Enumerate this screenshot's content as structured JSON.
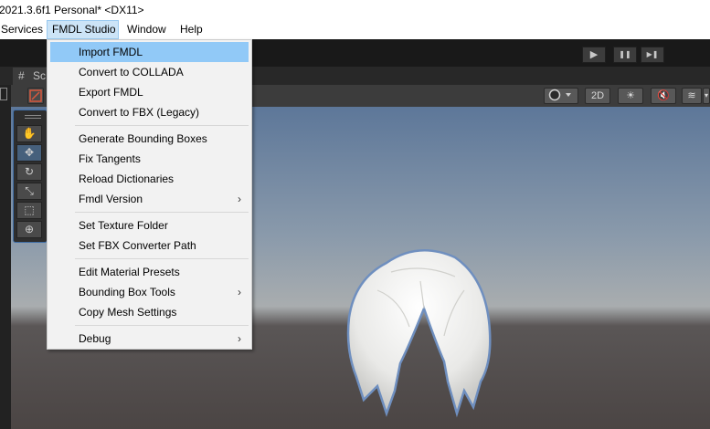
{
  "window": {
    "title": "2021.3.6f1 Personal* <DX11>"
  },
  "menubar": {
    "items": [
      "Services",
      "FMDL Studio",
      "Window",
      "Help"
    ]
  },
  "play_controls": {
    "play": "▶",
    "pause": "❚❚",
    "step": "▶❚"
  },
  "scene_tab": {
    "label": "Sc"
  },
  "scene_toolbar": {
    "mode_2d": "2D"
  },
  "dropdown": {
    "items": [
      {
        "label": "Import FMDL",
        "highlighted": true
      },
      {
        "label": "Convert to COLLADA"
      },
      {
        "label": "Export FMDL"
      },
      {
        "label": "Convert to FBX (Legacy)"
      },
      {
        "label": "Generate Bounding Boxes"
      },
      {
        "label": "Fix Tangents"
      },
      {
        "label": "Reload Dictionaries"
      },
      {
        "label": "Fmdl Version",
        "submenu": true
      },
      {
        "label": "Set Texture Folder"
      },
      {
        "label": "Set FBX Converter Path"
      },
      {
        "label": "Edit Material Presets"
      },
      {
        "label": "Bounding Box Tools",
        "submenu": true
      },
      {
        "label": "Copy Mesh Settings"
      },
      {
        "label": "Debug",
        "submenu": true
      }
    ],
    "submenu_arrow": "›"
  },
  "colors": {
    "highlight": "#91c9f7",
    "menubar_active": "#cce4f7",
    "tool_selected": "#46607c"
  }
}
